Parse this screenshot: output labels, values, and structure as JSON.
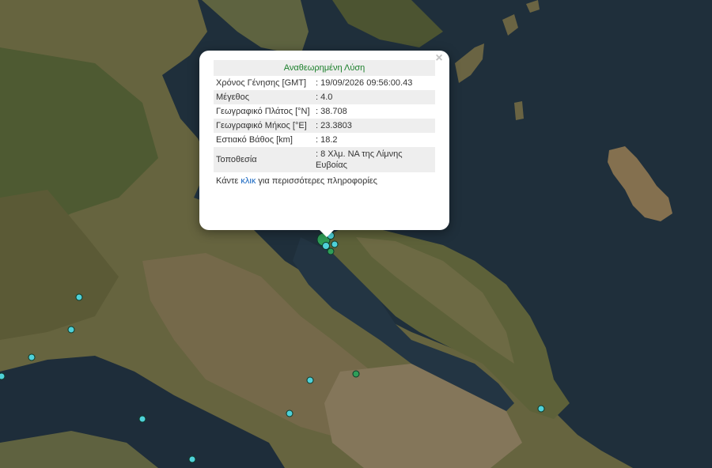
{
  "popup": {
    "header": "Αναθεωρημένη Λύση",
    "close_symbol": "×",
    "rows": [
      {
        "label": "Χρόνος Γένησης [GMT]",
        "value": ": 19/09/2026 09:56:00.43"
      },
      {
        "label": "Μέγεθος",
        "value": ": 4.0"
      },
      {
        "label": "Γεωγραφικό Πλάτος [°N]",
        "value": ": 38.708"
      },
      {
        "label": "Γεωγραφικό Μήκος [°E]",
        "value": ": 23.3803"
      },
      {
        "label": "Εστιακό Βάθος [km]",
        "value": ": 18.2"
      },
      {
        "label": "Τοποθεσία",
        "value": ": 8 Χλμ. ΝΑ της Λίμνης Ευβοίας"
      }
    ],
    "more_prefix": "Κάντε ",
    "more_link": "κλικ",
    "more_suffix": " για περισσότερες πληροφορίες"
  },
  "colors": {
    "sea_deep": "#1c2b36",
    "sea": "#243746",
    "land": "#6a6a45",
    "land_green": "#4f5a33",
    "land_brown": "#7d6c4a",
    "marker_cyan": "#4fd1d9",
    "marker_green": "#2f9e58",
    "popup_header": "#1a7f2a",
    "link": "#1565c0"
  },
  "markers": [
    {
      "id": "main-event",
      "type": "green-large"
    },
    {
      "id": "cluster-1",
      "type": "cyan"
    },
    {
      "id": "cluster-2",
      "type": "cyan"
    },
    {
      "id": "cluster-3",
      "type": "green"
    },
    {
      "id": "cluster-4",
      "type": "cyan"
    },
    {
      "id": "west-1",
      "type": "cyan"
    },
    {
      "id": "west-2",
      "type": "cyan"
    },
    {
      "id": "west-3",
      "type": "cyan"
    },
    {
      "id": "west-4",
      "type": "cyan"
    },
    {
      "id": "south-1",
      "type": "cyan"
    },
    {
      "id": "south-2",
      "type": "cyan"
    },
    {
      "id": "south-3",
      "type": "cyan"
    },
    {
      "id": "central-1",
      "type": "cyan"
    },
    {
      "id": "central-2",
      "type": "green"
    },
    {
      "id": "east-1",
      "type": "cyan"
    }
  ]
}
